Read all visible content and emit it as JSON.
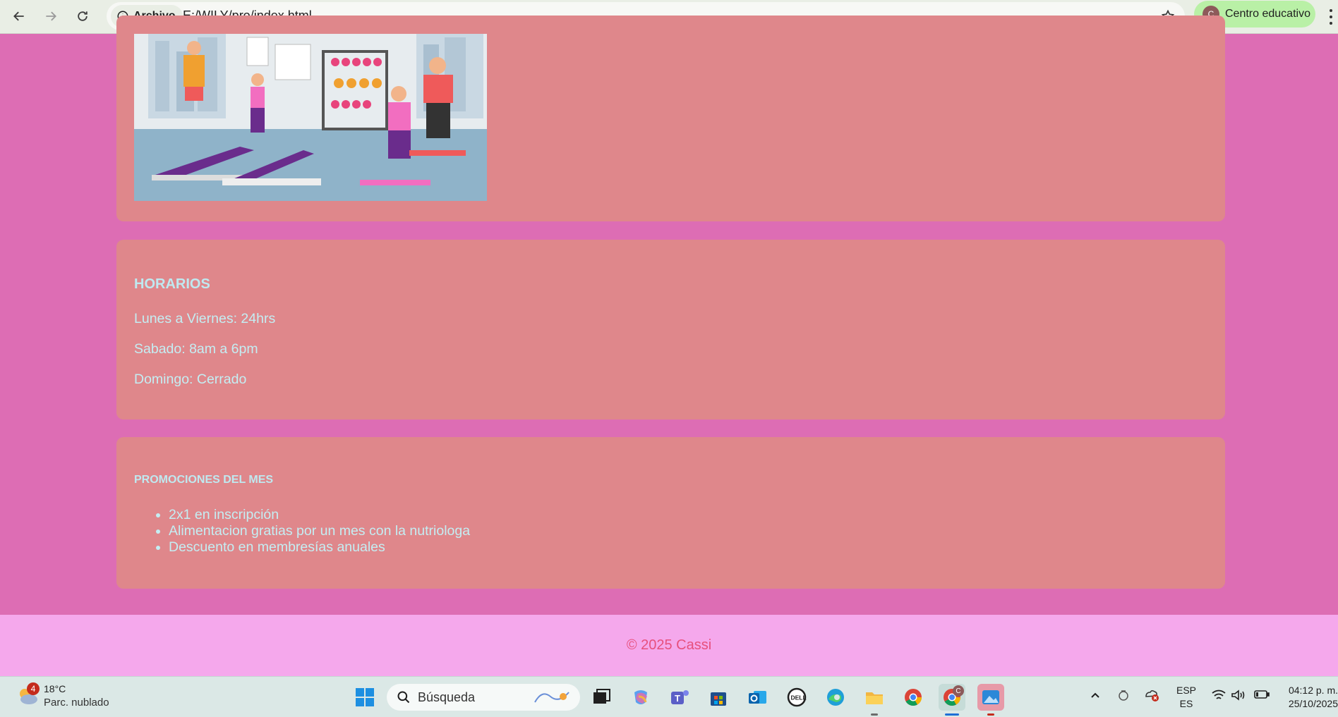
{
  "browser": {
    "back_icon": "back-arrow-icon",
    "forward_icon": "forward-arrow-icon",
    "reload_icon": "reload-icon",
    "site_info_label": "Archivo",
    "url": "E:/WILY/pro/index.html",
    "bookmark_icon": "star-icon",
    "profile_initial": "C",
    "profile_label": "Centro educativo"
  },
  "page": {
    "hero_image_alt": "gym illustration",
    "schedule": {
      "title": "HORARIOS",
      "lines": [
        "Lunes a Viernes: 24hrs",
        "Sabado: 8am a 6pm",
        "Domingo: Cerrado"
      ]
    },
    "promotions": {
      "title": "PROMOCIONES DEL MES",
      "items": [
        "2x1 en inscripción",
        "Alimentacion gratias por un mes con la nutriologa",
        "Descuento en membresías anuales"
      ]
    },
    "footer": "© 2025 Cassi",
    "colors": {
      "background": "#dd6db4",
      "card": "#df878b",
      "text": "#c4eef3",
      "footer": "#f5a8ec",
      "footer_text": "#e7507d"
    }
  },
  "taskbar": {
    "weather": {
      "badge": "4",
      "temp": "18°C",
      "desc": "Parc. nublado"
    },
    "search_placeholder": "Búsqueda",
    "apps": [
      "windows-start-icon",
      "task-view-icon",
      "copilot-icon",
      "teams-icon",
      "store-icon",
      "outlook-icon",
      "dell-icon",
      "edge-icon",
      "file-explorer-icon",
      "chrome-icon",
      "chrome-profile-icon",
      "photos-icon"
    ],
    "chrome_profile_badge": "C",
    "language": {
      "line1": "ESP",
      "line2": "ES"
    },
    "time": "04:12 p. m.",
    "date": "25/10/2025"
  }
}
